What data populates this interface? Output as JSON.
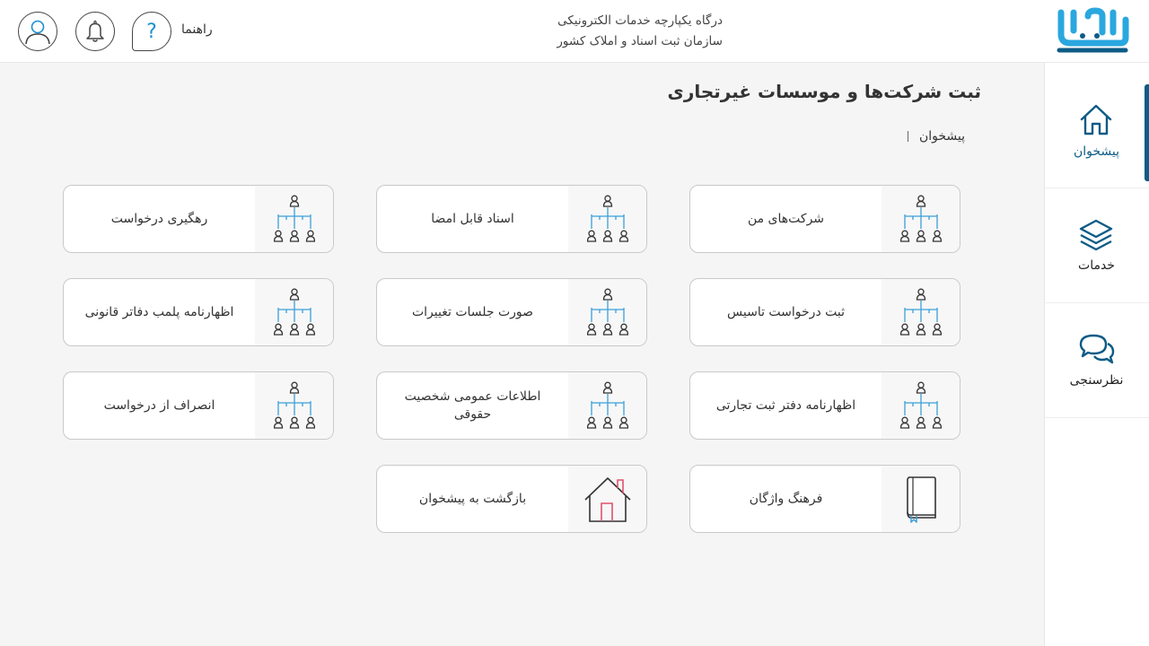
{
  "header": {
    "portal_line1": "درگاه یکپارچه خدمات الکترونیکی",
    "portal_line2": "سازمان ثبت اسناد و املاک کشور",
    "guide_label": "راهنما",
    "logo_alt": "ثبت من",
    "icons": [
      "help-icon",
      "bell-icon",
      "user-icon"
    ]
  },
  "sidebar": {
    "items": [
      {
        "label": "پیشخوان",
        "icon": "home-icon",
        "active": true
      },
      {
        "label": "خدمات",
        "icon": "layers-icon",
        "active": false
      },
      {
        "label": "نظرسنجی",
        "icon": "chat-icon",
        "active": false
      }
    ]
  },
  "main": {
    "title": "ثبت شرکت‌ها و موسسات غیرتجاری",
    "breadcrumb": "پیشخوان",
    "cards": [
      {
        "label": "شرکت‌های من",
        "icon": "org-chart-icon"
      },
      {
        "label": "اسناد قابل امضا",
        "icon": "org-chart-icon"
      },
      {
        "label": "رهگیری درخواست",
        "icon": "org-chart-icon"
      },
      {
        "label": "ثبت درخواست تاسیس",
        "icon": "org-chart-icon"
      },
      {
        "label": "صورت جلسات تغییرات",
        "icon": "org-chart-icon"
      },
      {
        "label": "اظهارنامه پلمب دفاتر قانونی",
        "icon": "org-chart-icon"
      },
      {
        "label": "اظهارنامه دفتر ثبت تجارتی",
        "icon": "org-chart-icon"
      },
      {
        "label": "اطلاعات عمومی شخصیت حقوقی",
        "icon": "org-chart-icon"
      },
      {
        "label": "انصراف از درخواست",
        "icon": "org-chart-icon"
      },
      {
        "label": "فرهنگ واژگان",
        "icon": "book-icon"
      },
      {
        "label": "بازگشت به پیشخوان",
        "icon": "house-icon"
      }
    ]
  },
  "colors": {
    "brand": "#0d5b86",
    "accent": "#1a8fd0",
    "icon_person": "#333333",
    "icon_line": "#3aa0d8",
    "house_door": "#e0516b"
  }
}
